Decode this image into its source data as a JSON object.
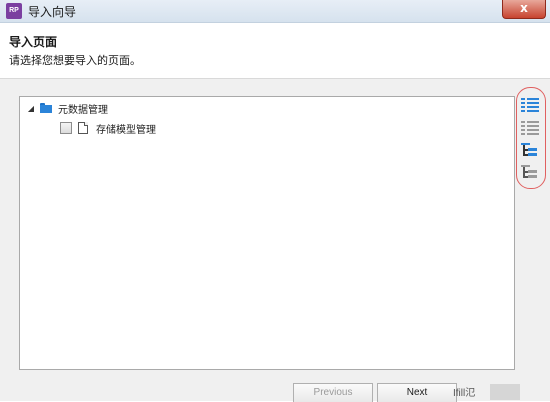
{
  "window": {
    "app_logo": "RP",
    "title": "导入向导",
    "close_label": "x"
  },
  "header": {
    "title": "导入页面",
    "subtitle": "请选择您想要导入的页面。"
  },
  "tree": {
    "root": {
      "expander": "◢",
      "label": "元数据管理",
      "expanded": true
    },
    "children": [
      {
        "label": "存储模型管理",
        "checked": false
      }
    ]
  },
  "side_tools": [
    {
      "icon": "check-all-icon"
    },
    {
      "icon": "uncheck-all-icon"
    },
    {
      "icon": "check-children-icon"
    },
    {
      "icon": "uncheck-children-icon"
    }
  ],
  "footer": {
    "previous_label": "Previous",
    "next_label": "Next",
    "watermark": "Ifill氾"
  },
  "colors": {
    "accent": "#2b84d9",
    "logo": "#7b3fa0",
    "close": "#c7432f",
    "highlight_circle": "#e06060"
  }
}
